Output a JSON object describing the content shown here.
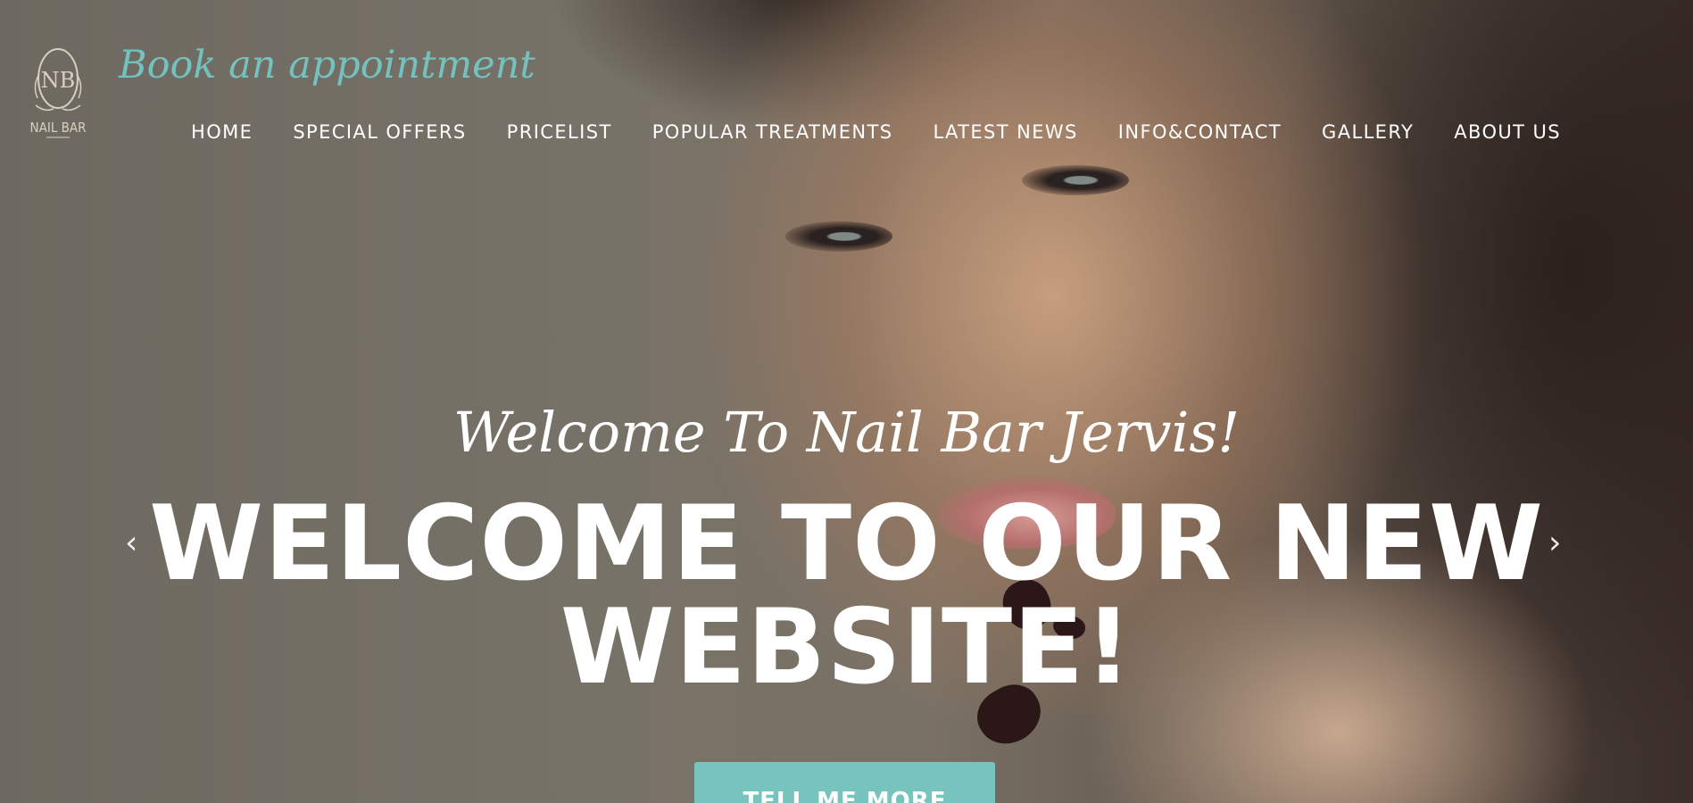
{
  "header": {
    "logo": {
      "monogram": "NB",
      "name": "NAIL BAR",
      "icon": "nail-bar-logo"
    },
    "book_label": "Book an appointment",
    "nav": [
      {
        "label": "HOME"
      },
      {
        "label": "SPECIAL OFFERS"
      },
      {
        "label": "PRICELIST"
      },
      {
        "label": "POPULAR TREATMENTS"
      },
      {
        "label": "LATEST NEWS"
      },
      {
        "label": "INFO&CONTACT"
      },
      {
        "label": "GALLERY"
      },
      {
        "label": "ABOUT US"
      }
    ]
  },
  "hero": {
    "subtitle": "Welcome To Nail Bar Jervis!",
    "headline_line1": "WELCOME TO OUR NEW",
    "headline_line2": "WEBSITE!",
    "prev_arrow": "‹",
    "next_arrow": "›",
    "cta_label": "TELL ME MORE"
  },
  "colors": {
    "accent": "#77c3bd",
    "book_link": "#73c2c0",
    "text": "#ffffff",
    "logo": "#d8cfc4"
  }
}
